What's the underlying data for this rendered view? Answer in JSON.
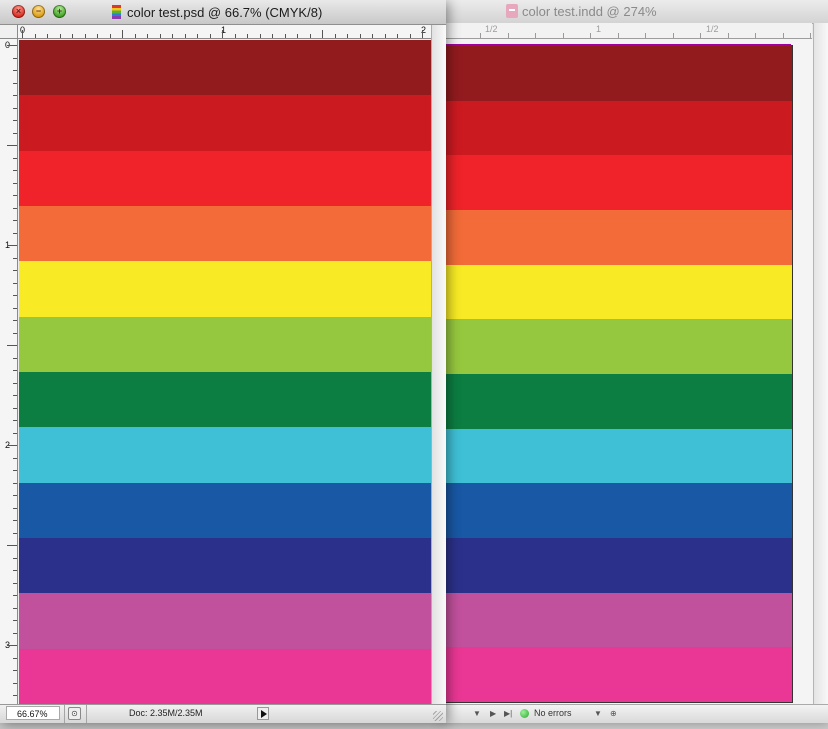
{
  "back_window": {
    "title": "color test.indd @ 274%",
    "ruler_labels": [
      "1/2",
      "1",
      "1/2"
    ],
    "status": {
      "errors_label": "No errors"
    }
  },
  "front_window": {
    "title": "color test.psd @ 66.7% (CMYK/8)",
    "ruler_h_labels": [
      "0",
      "1",
      "2"
    ],
    "ruler_v_labels": [
      "0",
      "1",
      "2",
      "3"
    ],
    "status": {
      "zoom": "66.67%",
      "doc_info": "Doc: 2.35M/2.35M"
    }
  },
  "stripes": [
    {
      "name": "dark-red",
      "color": "#921b1e"
    },
    {
      "name": "red",
      "color": "#cc1a21"
    },
    {
      "name": "bright-red",
      "color": "#ef2329"
    },
    {
      "name": "orange",
      "color": "#f26b38"
    },
    {
      "name": "yellow",
      "color": "#f8eb25"
    },
    {
      "name": "lime",
      "color": "#96c83f"
    },
    {
      "name": "green",
      "color": "#0c7e42"
    },
    {
      "name": "cyan",
      "color": "#3fc0d6"
    },
    {
      "name": "blue",
      "color": "#1858a5"
    },
    {
      "name": "navy",
      "color": "#2b318b"
    },
    {
      "name": "pink-violet",
      "color": "#c2519d"
    },
    {
      "name": "magenta",
      "color": "#ea3795"
    }
  ]
}
